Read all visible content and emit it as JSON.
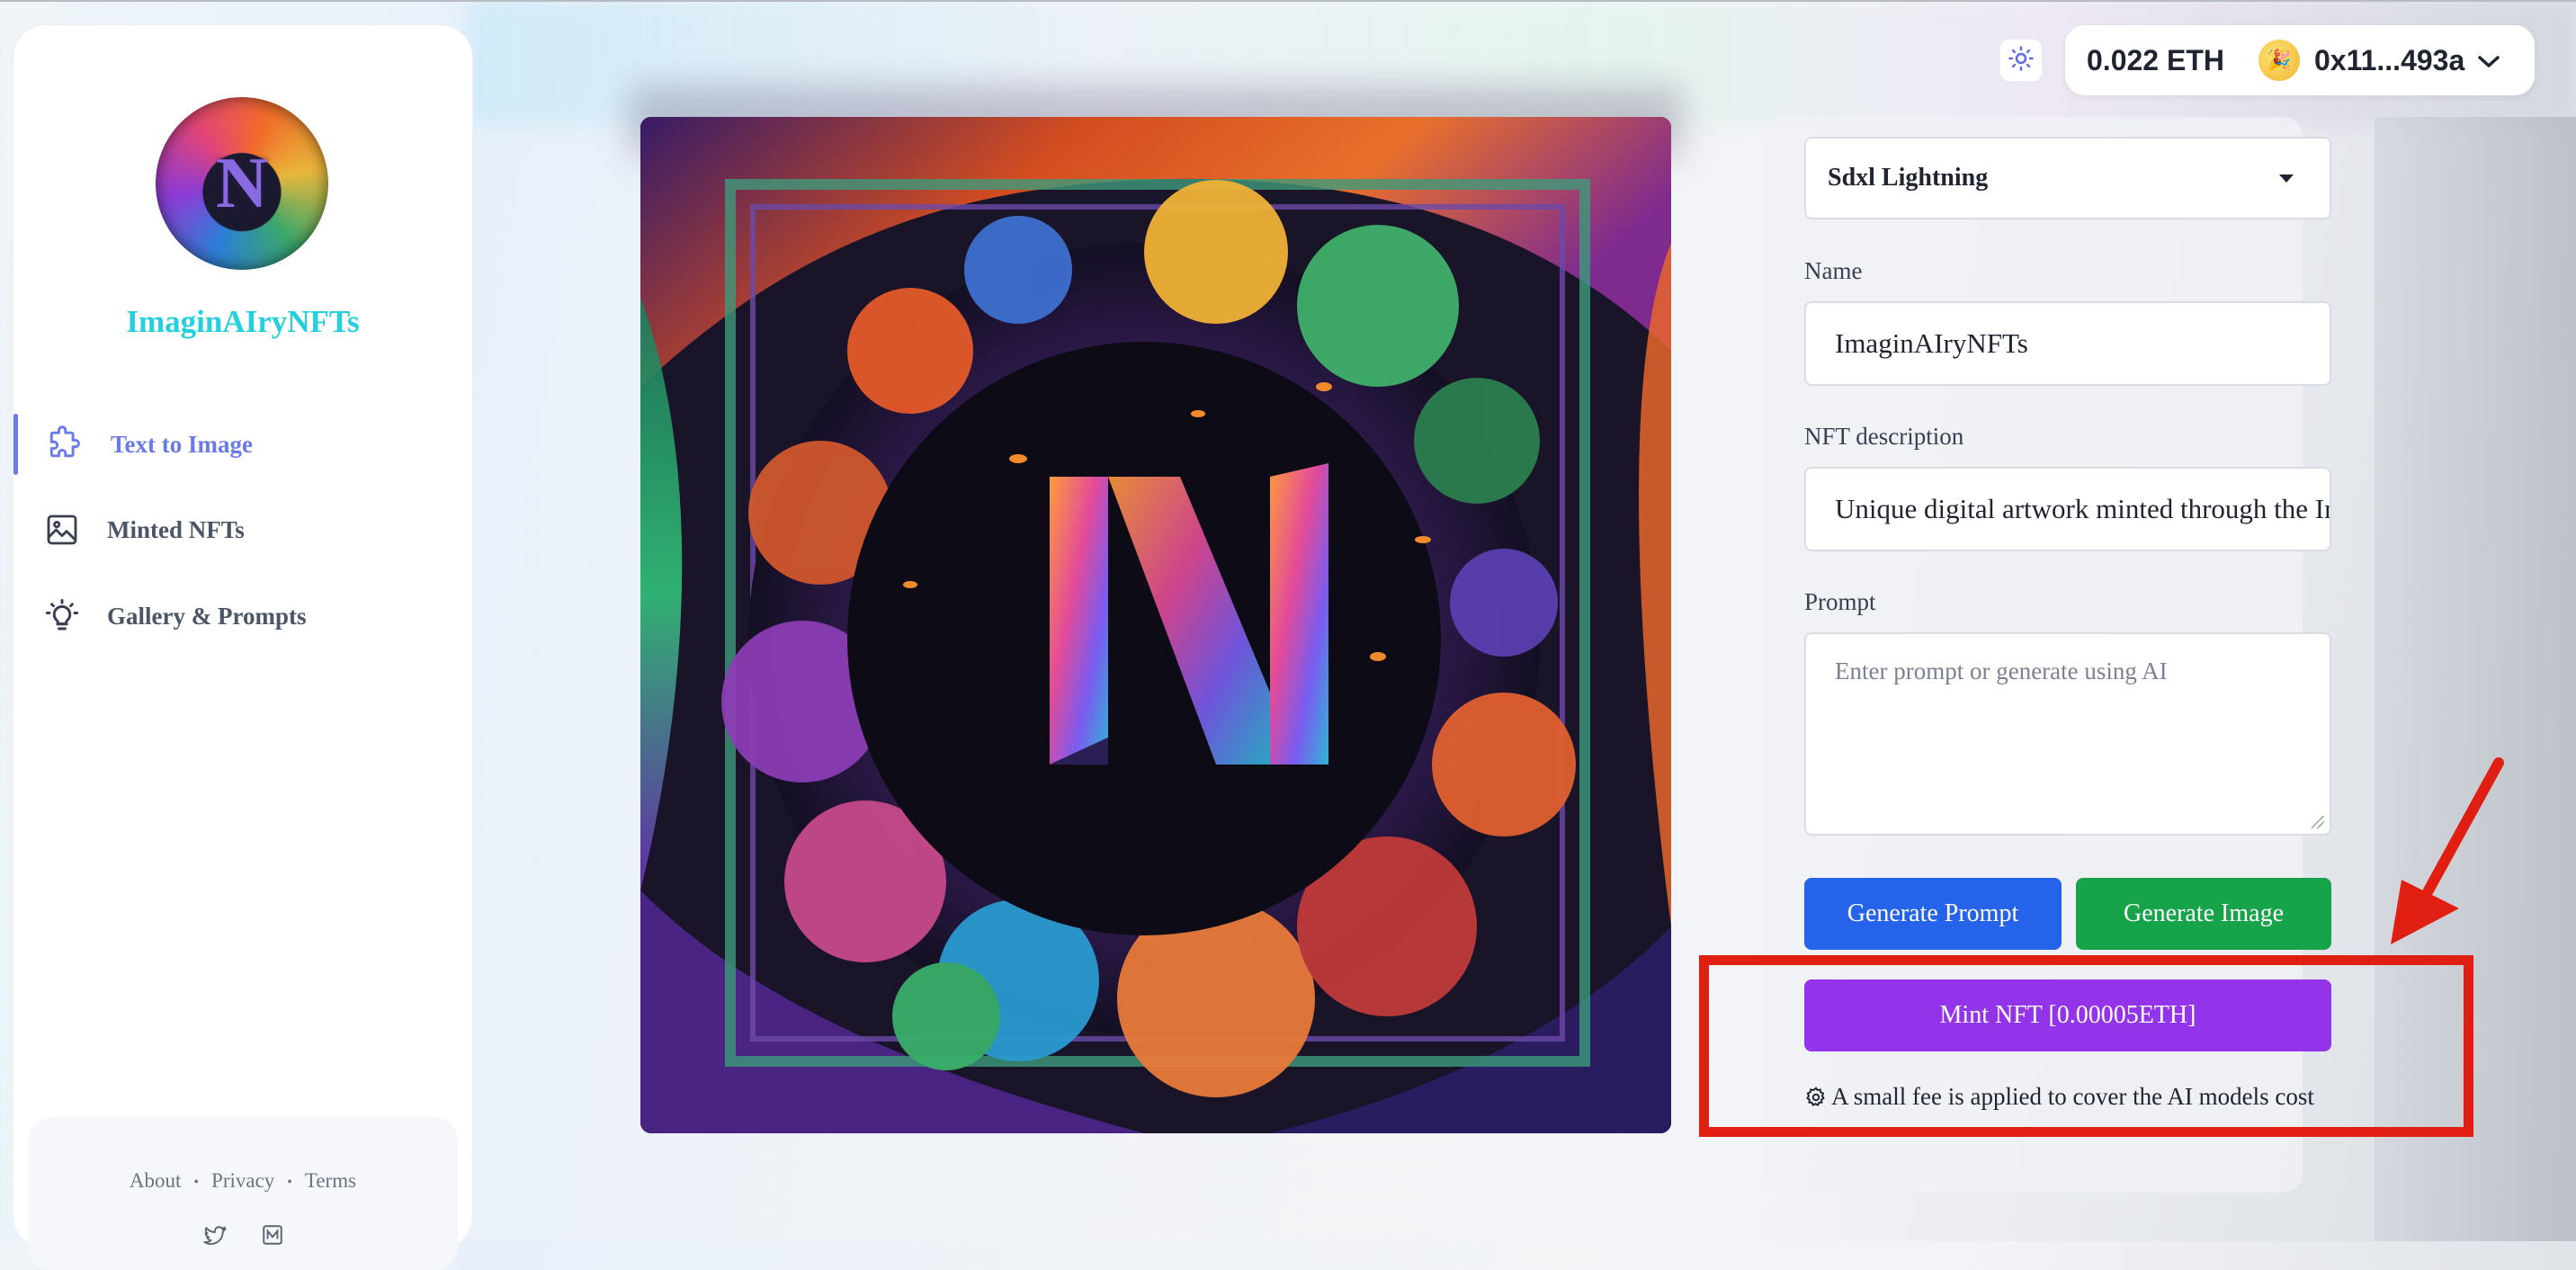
{
  "sidebar": {
    "brand": "ImaginAIryNFTs",
    "logo_letter": "N",
    "items": [
      {
        "label": "Text to Image",
        "icon": "puzzle-icon",
        "active": true
      },
      {
        "label": "Minted NFTs",
        "icon": "image-icon",
        "active": false
      },
      {
        "label": "Gallery & Prompts",
        "icon": "lightbulb-icon",
        "active": false
      }
    ],
    "footer": {
      "links": [
        "About",
        "Privacy",
        "Terms"
      ],
      "icons": [
        "twitter-icon",
        "medium-icon"
      ]
    }
  },
  "header": {
    "theme_icon": "sun-icon",
    "balance": "0.022 ETH",
    "avatar_glyph": "🎉",
    "address": "0x11...493a"
  },
  "form": {
    "model": "Sdxl Lightning",
    "name_label": "Name",
    "name_value": "ImaginAIryNFTs",
    "description_label": "NFT description",
    "description_value": "Unique digital artwork minted through the ImaginAIryNFTs platform",
    "prompt_label": "Prompt",
    "prompt_placeholder": "Enter prompt or generate using AI",
    "generate_prompt_label": "Generate Prompt",
    "generate_image_label": "Generate Image",
    "mint_label": "Mint NFT [0.00005ETH]",
    "fee_note": "A small fee is applied to cover the AI models cost"
  },
  "colors": {
    "brand": "#24d0de",
    "nav_active": "#6a7ae6",
    "generate_prompt": "#2563eb",
    "generate_image": "#16a34a",
    "mint": "#9333ea",
    "annotation": "#e01e12"
  }
}
